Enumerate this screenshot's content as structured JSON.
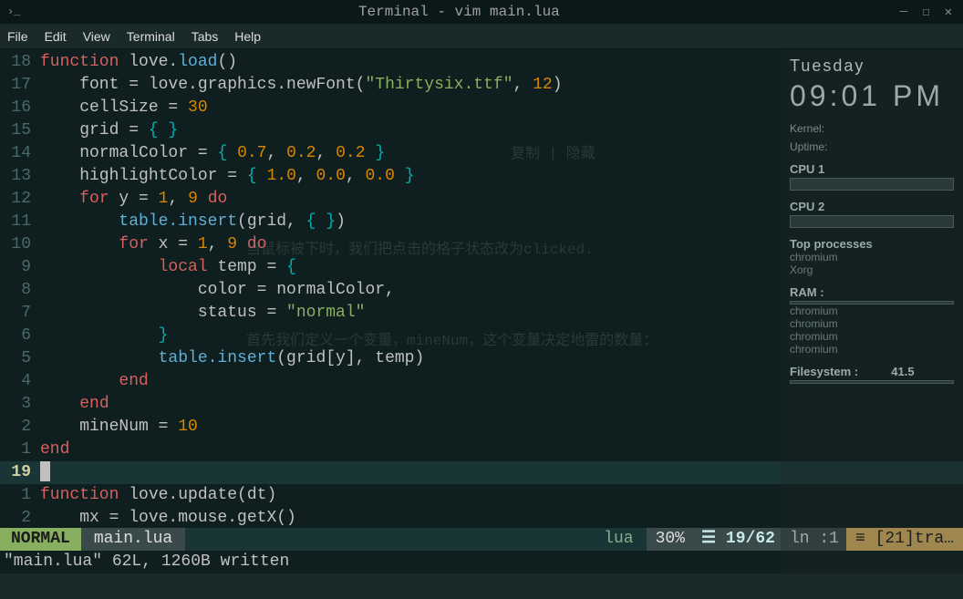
{
  "titlebar": {
    "title": "Terminal - vim main.lua"
  },
  "menubar": {
    "items": [
      "File",
      "Edit",
      "View",
      "Terminal",
      "Tabs",
      "Help"
    ]
  },
  "code": {
    "lines": [
      {
        "n": "18",
        "tokens": [
          {
            "c": "kw",
            "t": "function"
          },
          {
            "c": "norm",
            "t": " love."
          },
          {
            "c": "fn",
            "t": "load"
          },
          {
            "c": "norm",
            "t": "()"
          }
        ]
      },
      {
        "n": "17",
        "tokens": [
          {
            "c": "norm",
            "t": "    font = love.graphics.newFont("
          },
          {
            "c": "str",
            "t": "\"Thirtysix.ttf\""
          },
          {
            "c": "norm",
            "t": ", "
          },
          {
            "c": "num",
            "t": "12"
          },
          {
            "c": "norm",
            "t": ")"
          }
        ]
      },
      {
        "n": "16",
        "tokens": [
          {
            "c": "norm",
            "t": "    cellSize = "
          },
          {
            "c": "num",
            "t": "30"
          }
        ]
      },
      {
        "n": "15",
        "tokens": [
          {
            "c": "norm",
            "t": "    grid = "
          },
          {
            "c": "punct",
            "t": "{ }"
          }
        ]
      },
      {
        "n": "14",
        "tokens": [
          {
            "c": "norm",
            "t": "    normalColor = "
          },
          {
            "c": "punct",
            "t": "{"
          },
          {
            "c": "norm",
            "t": " "
          },
          {
            "c": "num",
            "t": "0.7"
          },
          {
            "c": "norm",
            "t": ", "
          },
          {
            "c": "num",
            "t": "0.2"
          },
          {
            "c": "norm",
            "t": ", "
          },
          {
            "c": "num",
            "t": "0.2"
          },
          {
            "c": "norm",
            "t": " "
          },
          {
            "c": "punct",
            "t": "}"
          }
        ]
      },
      {
        "n": "13",
        "tokens": [
          {
            "c": "norm",
            "t": "    highlightColor = "
          },
          {
            "c": "punct",
            "t": "{"
          },
          {
            "c": "norm",
            "t": " "
          },
          {
            "c": "num",
            "t": "1.0"
          },
          {
            "c": "norm",
            "t": ", "
          },
          {
            "c": "num",
            "t": "0.0"
          },
          {
            "c": "norm",
            "t": ", "
          },
          {
            "c": "num",
            "t": "0.0"
          },
          {
            "c": "norm",
            "t": " "
          },
          {
            "c": "punct",
            "t": "}"
          }
        ]
      },
      {
        "n": "12",
        "tokens": [
          {
            "c": "norm",
            "t": "    "
          },
          {
            "c": "kw",
            "t": "for"
          },
          {
            "c": "norm",
            "t": " y = "
          },
          {
            "c": "num",
            "t": "1"
          },
          {
            "c": "norm",
            "t": ", "
          },
          {
            "c": "num",
            "t": "9"
          },
          {
            "c": "norm",
            "t": " "
          },
          {
            "c": "kw",
            "t": "do"
          }
        ]
      },
      {
        "n": "11",
        "tokens": [
          {
            "c": "norm",
            "t": "        "
          },
          {
            "c": "fn",
            "t": "table.insert"
          },
          {
            "c": "norm",
            "t": "(grid, "
          },
          {
            "c": "punct",
            "t": "{ }"
          },
          {
            "c": "norm",
            "t": ")"
          }
        ]
      },
      {
        "n": "10",
        "tokens": [
          {
            "c": "norm",
            "t": "        "
          },
          {
            "c": "kw",
            "t": "for"
          },
          {
            "c": "norm",
            "t": " x = "
          },
          {
            "c": "num",
            "t": "1"
          },
          {
            "c": "norm",
            "t": ", "
          },
          {
            "c": "num",
            "t": "9"
          },
          {
            "c": "norm",
            "t": " "
          },
          {
            "c": "kw",
            "t": "do"
          }
        ]
      },
      {
        "n": "9",
        "tokens": [
          {
            "c": "norm",
            "t": "            "
          },
          {
            "c": "kw",
            "t": "local"
          },
          {
            "c": "norm",
            "t": " temp = "
          },
          {
            "c": "punct",
            "t": "{"
          }
        ]
      },
      {
        "n": "8",
        "tokens": [
          {
            "c": "norm",
            "t": "                color = normalColor,"
          }
        ]
      },
      {
        "n": "7",
        "tokens": [
          {
            "c": "norm",
            "t": "                status = "
          },
          {
            "c": "str",
            "t": "\"normal\""
          }
        ]
      },
      {
        "n": "6",
        "tokens": [
          {
            "c": "norm",
            "t": "            "
          },
          {
            "c": "punct",
            "t": "}"
          }
        ]
      },
      {
        "n": "5",
        "tokens": [
          {
            "c": "norm",
            "t": "            "
          },
          {
            "c": "fn",
            "t": "table.insert"
          },
          {
            "c": "norm",
            "t": "(grid[y], temp)"
          }
        ]
      },
      {
        "n": "4",
        "tokens": [
          {
            "c": "norm",
            "t": "        "
          },
          {
            "c": "kw",
            "t": "end"
          }
        ]
      },
      {
        "n": "3",
        "tokens": [
          {
            "c": "norm",
            "t": "    "
          },
          {
            "c": "kw",
            "t": "end"
          }
        ]
      },
      {
        "n": "2",
        "tokens": [
          {
            "c": "norm",
            "t": "    mineNum = "
          },
          {
            "c": "num",
            "t": "10"
          }
        ]
      },
      {
        "n": "1",
        "tokens": [
          {
            "c": "kw",
            "t": "end"
          }
        ]
      },
      {
        "n": "19",
        "cursor": true,
        "tokens": []
      },
      {
        "n": "1",
        "tokens": [
          {
            "c": "kw",
            "t": "function"
          },
          {
            "c": "norm",
            "t": " love.update(dt)"
          }
        ]
      },
      {
        "n": "2",
        "tokens": [
          {
            "c": "norm",
            "t": "    mx = love.mouse.getX()"
          }
        ]
      }
    ]
  },
  "status": {
    "mode": "NORMAL",
    "file": "main.lua",
    "filetype": "lua",
    "percent": "30%",
    "pos_icon": "☰",
    "position": "19/62",
    "col": "ln :1",
    "extra_icon": "≡",
    "extra": "[21]tra…"
  },
  "message": "\"main.lua\" 62L, 1260B written",
  "conky": {
    "day": "Tuesday",
    "time": "09:01 PM",
    "kernel": "Kernel:",
    "uptime": "Uptime:",
    "cpu1": "CPU 1",
    "cpu2": "CPU 2",
    "top": "Top processes",
    "procs": [
      "chromium",
      "Xorg"
    ],
    "ram": "RAM :",
    "ramprocs": [
      "chromium",
      "chromium",
      "chromium",
      "chromium"
    ],
    "fs": "Filesystem :",
    "fsval": "41.5"
  },
  "ghost": {
    "g1": "复制  |  隐藏",
    "g2": "当鼠标被下时，我们把点击的格子状态改为clicked.",
    "g3": "首先我们定义一个变量，mineNum，这个变量决定地雷的数量："
  }
}
